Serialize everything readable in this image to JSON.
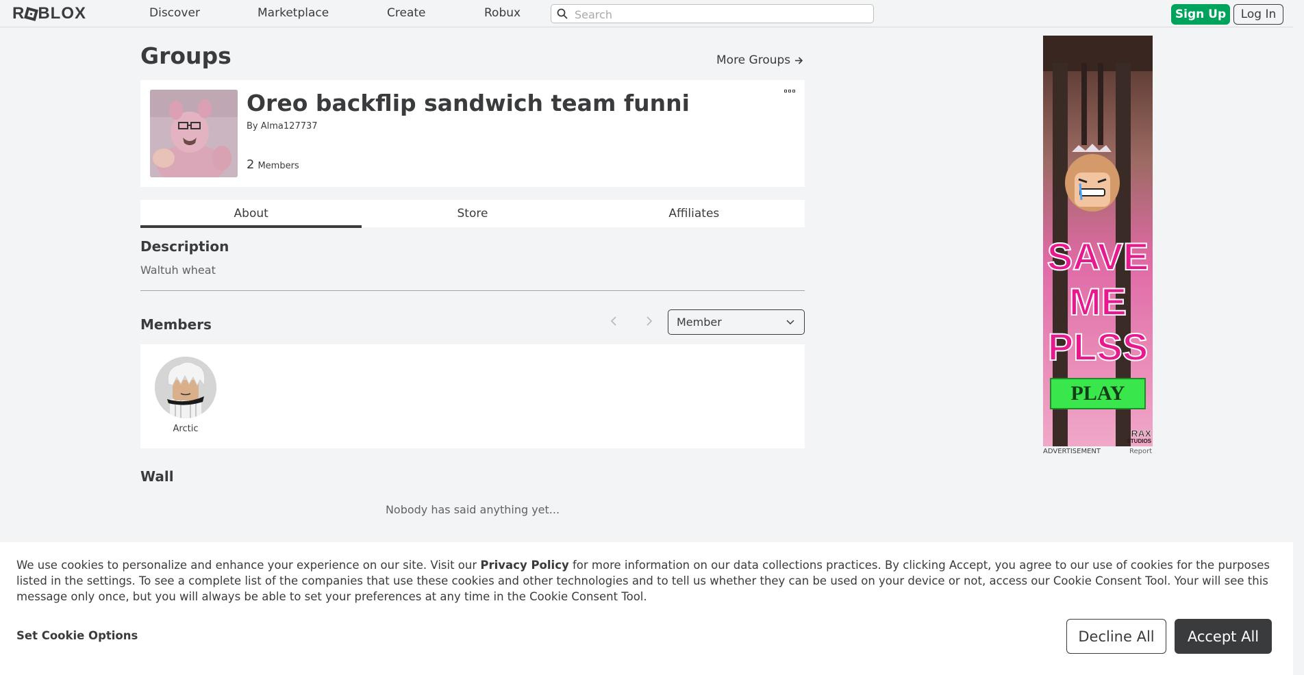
{
  "nav": {
    "logo": "ROBLOX",
    "links": [
      "Discover",
      "Marketplace",
      "Create",
      "Robux"
    ],
    "search_placeholder": "Search",
    "signup_label": "Sign Up",
    "login_label": "Log In"
  },
  "page": {
    "title": "Groups",
    "more_groups": "More Groups"
  },
  "group": {
    "name": "Oreo backflip sandwich team funni",
    "by_prefix": "By",
    "owner": "Alma127737",
    "member_count": "2",
    "member_count_label": "Members"
  },
  "tabs": [
    "About",
    "Store",
    "Affiliates"
  ],
  "about": {
    "description_title": "Description",
    "description_text": "Waltuh wheat",
    "members_title": "Members",
    "role_selected": "Member",
    "members": [
      {
        "name": "Arctic"
      }
    ],
    "wall_title": "Wall",
    "wall_empty": "Nobody has said anything yet..."
  },
  "ad": {
    "headline": [
      "SAVE",
      "ME",
      "PLSS"
    ],
    "cta": "PLAY",
    "studio": [
      "RAX",
      "STUDIOS"
    ],
    "label": "ADVERTISEMENT",
    "report": "Report"
  },
  "cookie": {
    "text_before": "We use cookies to personalize and enhance your experience on our site. Visit our ",
    "privacy_policy": "Privacy Policy",
    "text_after": " for more information on our data collections practices. By clicking Accept, you agree to our use of cookies for the purposes listed in the settings. To see a complete list of the companies that use these cookies and other technologies and to tell us whether they can be used on your device or not, access our Cookie Consent Tool. Your will see this message only once, but you will always be able to set your preferences at any time in the Cookie Consent Tool.",
    "options_label": "Set Cookie Options",
    "decline_label": "Decline All",
    "accept_label": "Accept All"
  },
  "colors": {
    "signup_green": "#00a35c",
    "ad_pink": "#e8188f",
    "ad_play_green": "#39e64b",
    "text_dark": "#393b3d",
    "page_bg": "#f2f4f5"
  }
}
